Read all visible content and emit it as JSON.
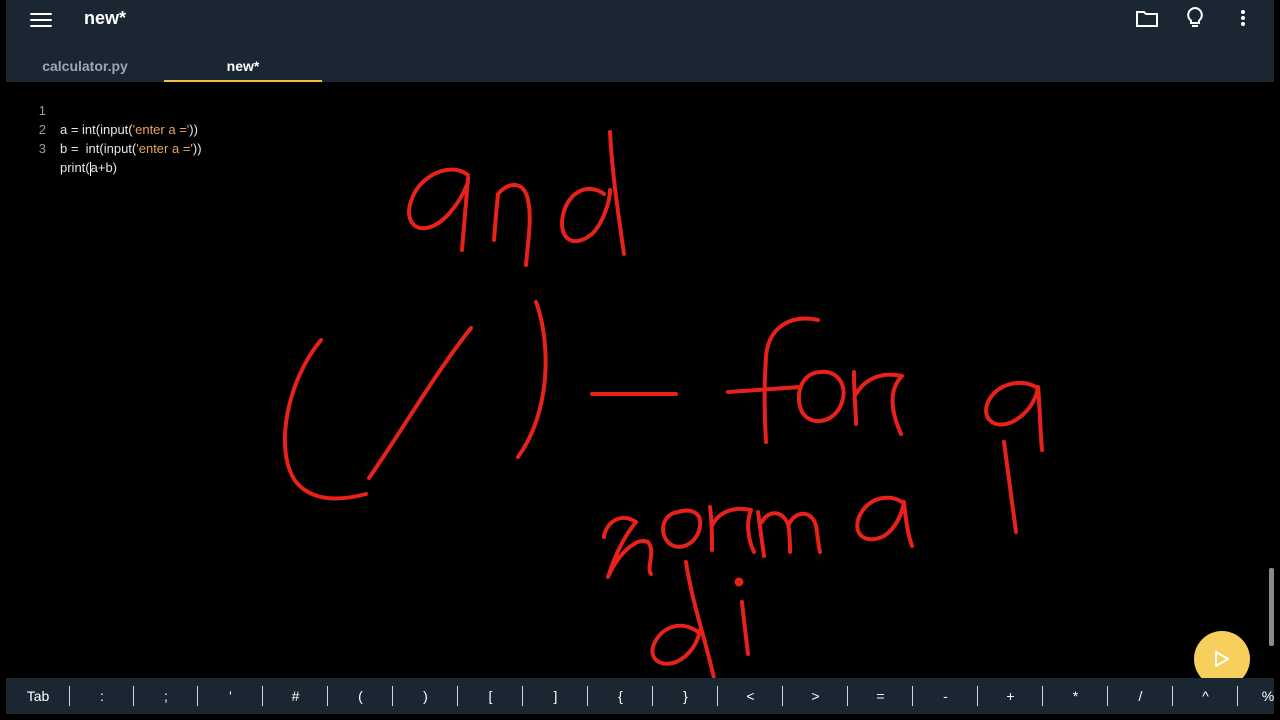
{
  "app": {
    "title": "new*"
  },
  "tabs": [
    {
      "label": "calculator.py",
      "active": false
    },
    {
      "label": "new*",
      "active": true
    }
  ],
  "icons": {
    "menu": "hamburger-icon",
    "folder": "folder-icon",
    "lightbulb": "lightbulb-icon",
    "more": "more-vertical-icon",
    "run": "play-icon"
  },
  "editor": {
    "lines": [
      {
        "number": "1",
        "pre": "a = int(input(",
        "str": "'enter a ='",
        "post": "))"
      },
      {
        "number": "2",
        "pre": "b =  int(input(",
        "str": "'enter a ='",
        "post": "))"
      },
      {
        "number": "3",
        "pre": "print(",
        "str": "",
        "post": "a+b)"
      }
    ],
    "annotation": [
      "and",
      "(/) — for a",
      "normal",
      "di"
    ]
  },
  "symbols": [
    "Tab",
    ":",
    ";",
    "'",
    "#",
    "(",
    ")",
    "[",
    "]",
    "{",
    "}",
    "<",
    ">",
    "=",
    "-",
    "+",
    "*",
    "/",
    "^",
    "%"
  ],
  "colors": {
    "toolbar": "#1a2733",
    "accent": "#f0c24b",
    "run_button": "#f6cf5d",
    "string": "#e9a35c",
    "ink": "#e8221a"
  }
}
